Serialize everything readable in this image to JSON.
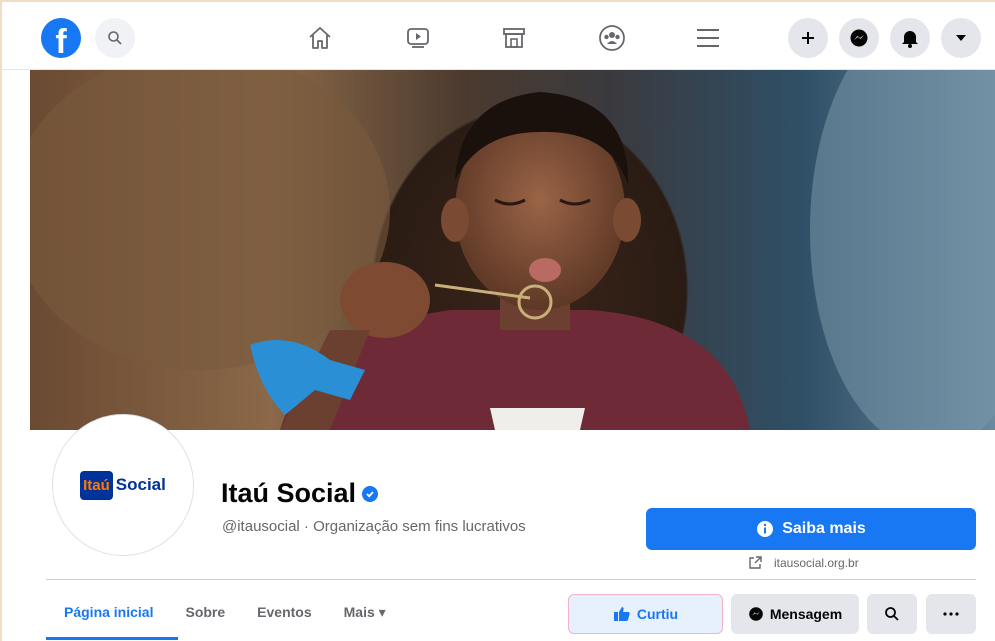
{
  "page": {
    "name": "Itaú Social",
    "handle_category": "@itausocial · Organização sem fins lucrativos",
    "logo_part1": "Itaú",
    "logo_part2": "Social",
    "website": "itausocial.org.br"
  },
  "actions": {
    "learn_more": "Saiba mais",
    "liked": "Curtiu",
    "message": "Mensagem"
  },
  "tabs": [
    {
      "label": "Página inicial",
      "active": true
    },
    {
      "label": "Sobre"
    },
    {
      "label": "Eventos"
    },
    {
      "label": "Mais ▾"
    }
  ],
  "colors": {
    "brand": "#1877f2",
    "itau_blue": "#003399",
    "itau_orange": "#ff7a00"
  },
  "icons": [
    "facebook-logo-icon",
    "search-icon",
    "home-icon",
    "watch-icon",
    "marketplace-icon",
    "groups-icon",
    "menu-icon",
    "plus-icon",
    "messenger-icon",
    "notifications-icon",
    "account-caret-icon"
  ]
}
